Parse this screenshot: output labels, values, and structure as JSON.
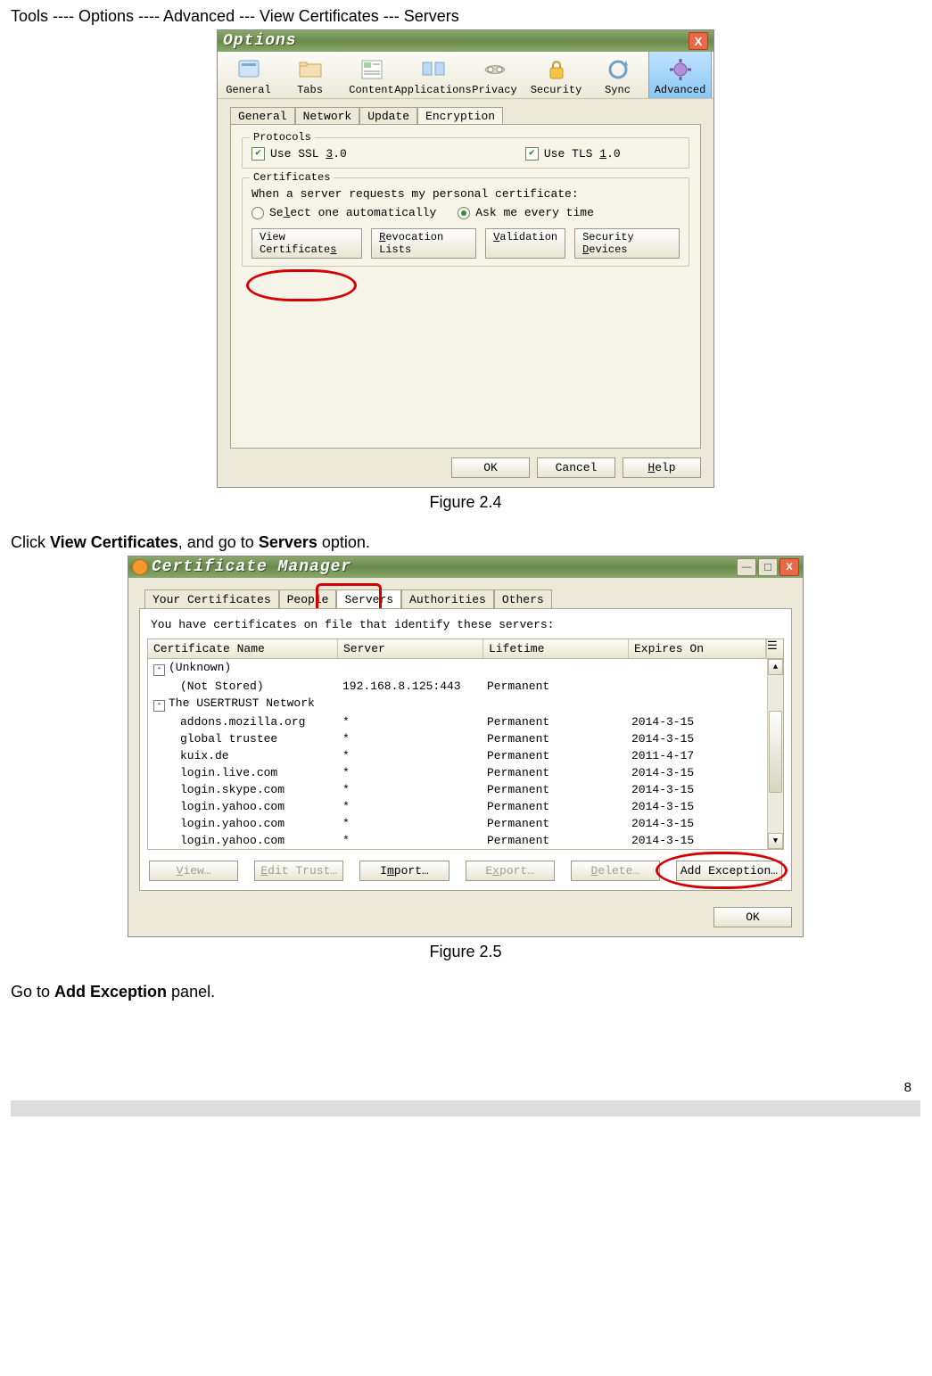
{
  "doc": {
    "breadcrumb": "Tools ---- Options ---- Advanced --- View Certificates --- Servers",
    "fig24": "Figure 2.4",
    "para2_prefix": "Click ",
    "para2_b1": "View Certificates",
    "para2_mid": ", and go to ",
    "para2_b2": "Servers",
    "para2_suffix": " option.",
    "fig25": "Figure 2.5",
    "para3_prefix": "Go to ",
    "para3_b": "Add Exception",
    "para3_suffix": " panel.",
    "page_number": "8"
  },
  "options_window": {
    "title": "Options",
    "close": "X",
    "toolbar": [
      "General",
      "Tabs",
      "Content",
      "Applications",
      "Privacy",
      "Security",
      "Sync",
      "Advanced"
    ],
    "subtabs": [
      "General",
      "Network",
      "Update",
      "Encryption"
    ],
    "protocols": {
      "legend": "Protocols",
      "ssl": "Use SSL 3.0",
      "tls": "Use TLS 1.0"
    },
    "certs": {
      "legend": "Certificates",
      "when": "When a server requests my personal certificate:",
      "opt_auto": "Select one automatically",
      "opt_ask": "Ask me every time",
      "btn_view": "View Certificates",
      "btn_rev": "Revocation Lists",
      "btn_val": "Validation",
      "btn_dev": "Security Devices"
    },
    "footer": {
      "ok": "OK",
      "cancel": "Cancel",
      "help": "Help"
    }
  },
  "cert_manager": {
    "title": "Certificate Manager",
    "tabs": [
      "Your Certificates",
      "People",
      "Servers",
      "Authorities",
      "Others"
    ],
    "hint": "You have certificates on file that identify these servers:",
    "cols": [
      "Certificate Name",
      "Server",
      "Lifetime",
      "Expires On"
    ],
    "rows": [
      {
        "type": "group",
        "name": "(Unknown)"
      },
      {
        "type": "item",
        "name": "(Not Stored)",
        "server": "192.168.8.125:443",
        "lifetime": "Permanent",
        "expires": ""
      },
      {
        "type": "group",
        "name": "The USERTRUST Network"
      },
      {
        "type": "item",
        "name": "addons.mozilla.org",
        "server": "*",
        "lifetime": "Permanent",
        "expires": "2014-3-15"
      },
      {
        "type": "item",
        "name": "global trustee",
        "server": "*",
        "lifetime": "Permanent",
        "expires": "2014-3-15"
      },
      {
        "type": "item",
        "name": "kuix.de",
        "server": "*",
        "lifetime": "Permanent",
        "expires": "2011-4-17"
      },
      {
        "type": "item",
        "name": "login.live.com",
        "server": "*",
        "lifetime": "Permanent",
        "expires": "2014-3-15"
      },
      {
        "type": "item",
        "name": "login.skype.com",
        "server": "*",
        "lifetime": "Permanent",
        "expires": "2014-3-15"
      },
      {
        "type": "item",
        "name": "login.yahoo.com",
        "server": "*",
        "lifetime": "Permanent",
        "expires": "2014-3-15"
      },
      {
        "type": "item",
        "name": "login.yahoo.com",
        "server": "*",
        "lifetime": "Permanent",
        "expires": "2014-3-15"
      },
      {
        "type": "item",
        "name": "login.yahoo.com",
        "server": "*",
        "lifetime": "Permanent",
        "expires": "2014-3-15"
      }
    ],
    "buttons": {
      "view": "View…",
      "edit": "Edit Trust…",
      "import": "Import…",
      "export": "Export…",
      "delete": "Delete…",
      "add": "Add Exception…"
    },
    "ok": "OK"
  }
}
